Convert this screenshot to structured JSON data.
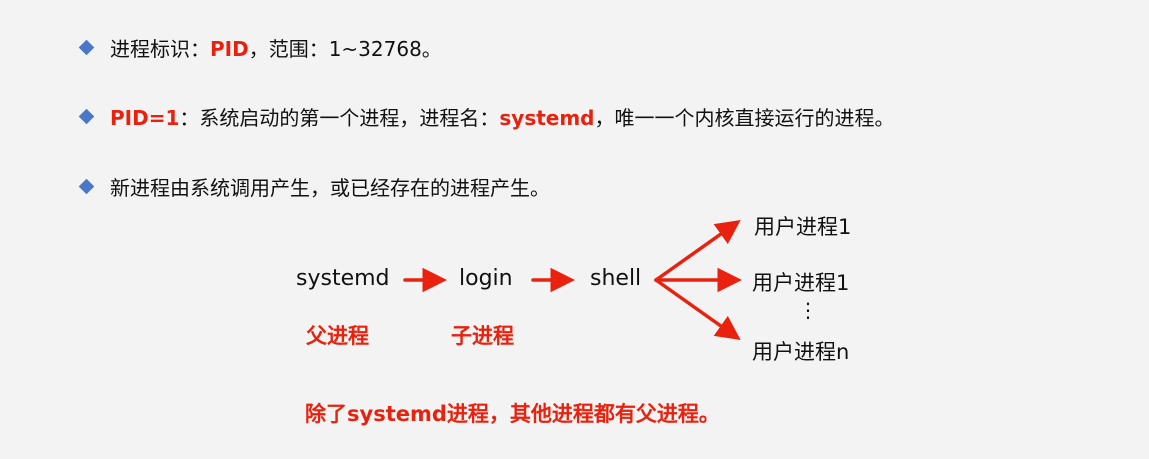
{
  "bullets": [
    {
      "parts": [
        {
          "text": "进程标识：",
          "red": false
        },
        {
          "text": "PID",
          "red": true
        },
        {
          "text": "，范围：1~32768。",
          "red": false
        }
      ]
    },
    {
      "parts": [
        {
          "text": "PID=1",
          "red": true
        },
        {
          "text": "：系统启动的第一个进程，进程名：",
          "red": false
        },
        {
          "text": "systemd",
          "red": true
        },
        {
          "text": "，唯一一个内核直接运行的进程。",
          "red": false
        }
      ]
    },
    {
      "parts": [
        {
          "text": "新进程由系统调用产生，或已经存在的进程产生。",
          "red": false
        }
      ]
    }
  ],
  "diagram": {
    "nodes": {
      "systemd": "systemd",
      "login": "login",
      "shell": "shell",
      "user1": "用户进程1",
      "user2": "用户进程1",
      "ellipsis": "⋮",
      "usern": "用户进程n"
    },
    "roles": {
      "parent": "父进程",
      "child": "子进程"
    },
    "note": "除了systemd进程，其他进程都有父进程。"
  },
  "colors": {
    "accent_red": "#e8220e",
    "bullet_blue": "#4a78c8",
    "background": "#f3f3f3"
  }
}
